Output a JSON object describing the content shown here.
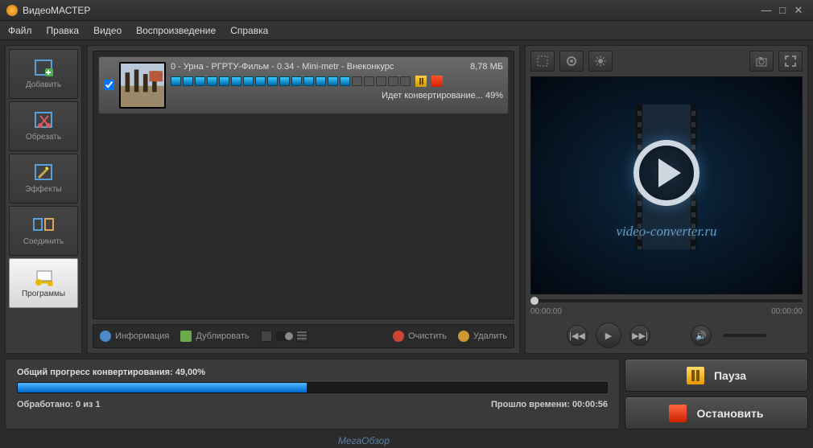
{
  "window": {
    "title": "ВидеоМАСТЕР"
  },
  "menu": {
    "file": "Файл",
    "edit": "Правка",
    "video": "Видео",
    "playback": "Воспроизведение",
    "help": "Справка"
  },
  "sidebar": {
    "add": "Добавить",
    "trim": "Обрезать",
    "effects": "Эффекты",
    "join": "Соединить",
    "programs": "Программы"
  },
  "file": {
    "name": "0 - Урна - РГРТУ-Фильм - 0.34 - Mini-metr - Внеконкурс",
    "size": "8,78 МБ",
    "status": "Идет конвертирование... 49%",
    "segments_filled": 15,
    "segments_total": 20
  },
  "listtools": {
    "info": "Информация",
    "duplicate": "Дублировать",
    "clear": "Очистить",
    "delete": "Удалить"
  },
  "preview": {
    "watermark": "video-converter.ru",
    "time_current": "00:00:00",
    "time_total": "00:00:00"
  },
  "progress": {
    "label": "Общий прогресс конвертирования: 49,00%",
    "percent": 49,
    "processed_label": "Обработано: 0 из 1",
    "elapsed_label": "Прошло времени: 00:00:56"
  },
  "actions": {
    "pause": "Пауза",
    "stop": "Остановить"
  },
  "corner_watermark": "МегаОбзор"
}
